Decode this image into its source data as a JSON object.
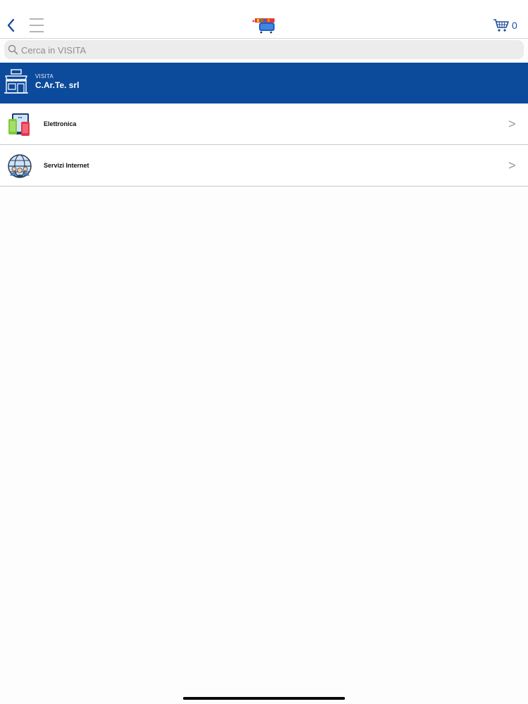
{
  "topbar": {
    "cart_count": "0"
  },
  "search": {
    "placeholder": "Cerca in VISITA"
  },
  "shop": {
    "kicker": "VISITA",
    "name": "C.Ar.Te. srl"
  },
  "categories": [
    {
      "label": "Elettronica",
      "icon": "electronics-icon"
    },
    {
      "label": "Servizi Internet",
      "icon": "globe-users-icon"
    }
  ],
  "colors": {
    "brand_blue": "#0c4a9c",
    "accent_blue": "#1f4e9a"
  }
}
